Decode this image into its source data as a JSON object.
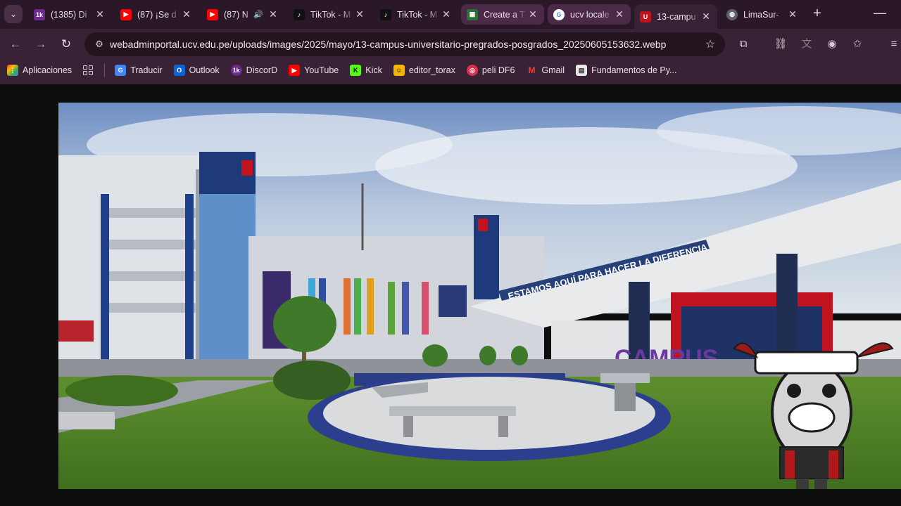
{
  "tabs": [
    {
      "title": "(1385) Di",
      "icon": "kick-like-icon",
      "color": "#c23c5a"
    },
    {
      "title": "(87) ¡Se d",
      "icon": "youtube-icon",
      "color": "#ff0000"
    },
    {
      "title": "(87) N",
      "icon": "youtube-icon",
      "color": "#ff0000",
      "audio": true
    },
    {
      "title": "TikTok - M",
      "icon": "tiktok-icon",
      "color": "#111111"
    },
    {
      "title": "TikTok - M",
      "icon": "tiktok-icon",
      "color": "#111111"
    },
    {
      "title": "Create a T",
      "icon": "app-icon",
      "color": "#2d6e3a"
    },
    {
      "title": "ucv locale",
      "icon": "google-icon",
      "color": "#ffffff"
    },
    {
      "title": "13-campu",
      "icon": "ucv-icon",
      "color": "#c1121f"
    },
    {
      "title": "LimaSur-",
      "icon": "globe-icon",
      "color": "#9aa0a6"
    }
  ],
  "address_bar": {
    "url": "webadminportal.ucv.edu.pe/uploads/images/2025/mayo/13-campus-universitario-pregrados-posgrados_20250605153632.webp"
  },
  "bookmarks": [
    {
      "label": "Aplicaciones",
      "icon": "apps-icon",
      "color": "#ea4335"
    },
    {
      "label": "Traducir",
      "icon": "translate-icon",
      "color": "#4285f4"
    },
    {
      "label": "Outlook",
      "icon": "outlook-icon",
      "color": "#0a64d6"
    },
    {
      "label": "DiscorD",
      "icon": "discord-icon",
      "color": "#5865f2"
    },
    {
      "label": "YouTube",
      "icon": "youtube-icon",
      "color": "#ff0000"
    },
    {
      "label": "Kick",
      "icon": "kick-icon",
      "color": "#53fc18"
    },
    {
      "label": "editor_torax",
      "icon": "editor-icon",
      "color": "#f4b400"
    },
    {
      "label": "peli DF6",
      "icon": "peli-icon",
      "color": "#d93050"
    },
    {
      "label": "Gmail",
      "icon": "gmail-icon",
      "color": "#ea4335"
    },
    {
      "label": "Fundamentos de Py...",
      "icon": "doc-icon",
      "color": "#e8e8e8"
    }
  ],
  "photo": {
    "sign_text": "ESTAMOS AQUÍ PARA HACER LA DIFERENCIA",
    "campus_text": "CAMPUS"
  }
}
